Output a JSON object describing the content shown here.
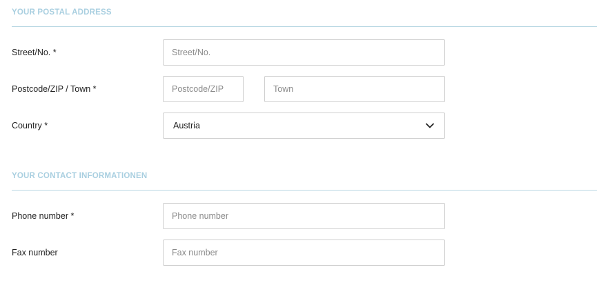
{
  "postal": {
    "heading": "YOUR POSTAL ADDRESS",
    "street": {
      "label": "Street/No. *",
      "placeholder": "Street/No."
    },
    "postcode_town": {
      "label": "Postcode/ZIP / Town *",
      "postcode_placeholder": "Postcode/ZIP",
      "town_placeholder": "Town"
    },
    "country": {
      "label": "Country *",
      "value": "Austria",
      "icon": "chevron-down-icon"
    }
  },
  "contact": {
    "heading": "YOUR CONTACT INFORMATIONEN",
    "phone": {
      "label": "Phone number *",
      "placeholder": "Phone number"
    },
    "fax": {
      "label": "Fax number",
      "placeholder": "Fax number"
    }
  },
  "colors": {
    "heading": "#a9cfe0",
    "rule": "#b9d8e3",
    "border": "#cfcfcf",
    "placeholder": "#8a8a8a"
  }
}
